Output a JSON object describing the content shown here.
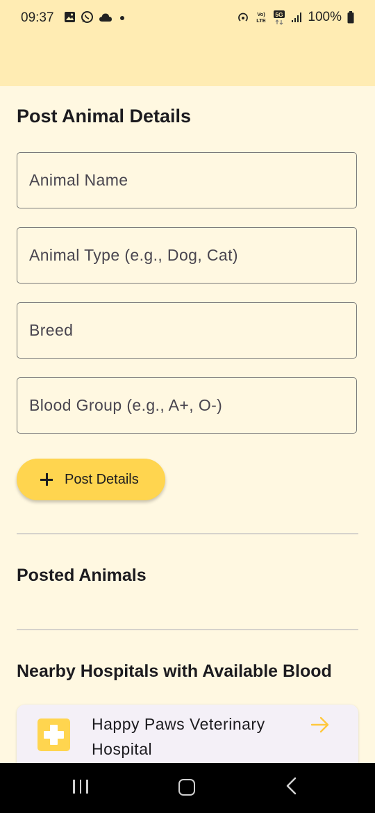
{
  "status_bar": {
    "time": "09:37",
    "battery": "100%",
    "left_icons": [
      "gallery-icon",
      "whatsapp-icon",
      "cloud-icon",
      "dot-icon"
    ],
    "right_icons": [
      "hotspot-icon",
      "volte-icon",
      "5g-icon",
      "signal-icon",
      "battery-icon"
    ]
  },
  "form": {
    "title": "Post Animal Details",
    "fields": [
      {
        "placeholder": "Animal Name",
        "value": ""
      },
      {
        "placeholder": "Animal Type (e.g., Dog, Cat)",
        "value": ""
      },
      {
        "placeholder": "Breed",
        "value": ""
      },
      {
        "placeholder": "Blood Group (e.g., A+, O-)",
        "value": ""
      }
    ],
    "submit_label": "Post Details"
  },
  "posted_animals": {
    "title": "Posted Animals"
  },
  "hospitals": {
    "title": "Nearby Hospitals with Available Blood",
    "items": [
      {
        "name": "Happy Paws Veterinary Hospital",
        "icon": "hospital-icon"
      }
    ]
  },
  "colors": {
    "background": "#FFF8E1",
    "app_bar": "#FFECB3",
    "accent": "#FFD54F",
    "card": "#F4F0F7"
  }
}
